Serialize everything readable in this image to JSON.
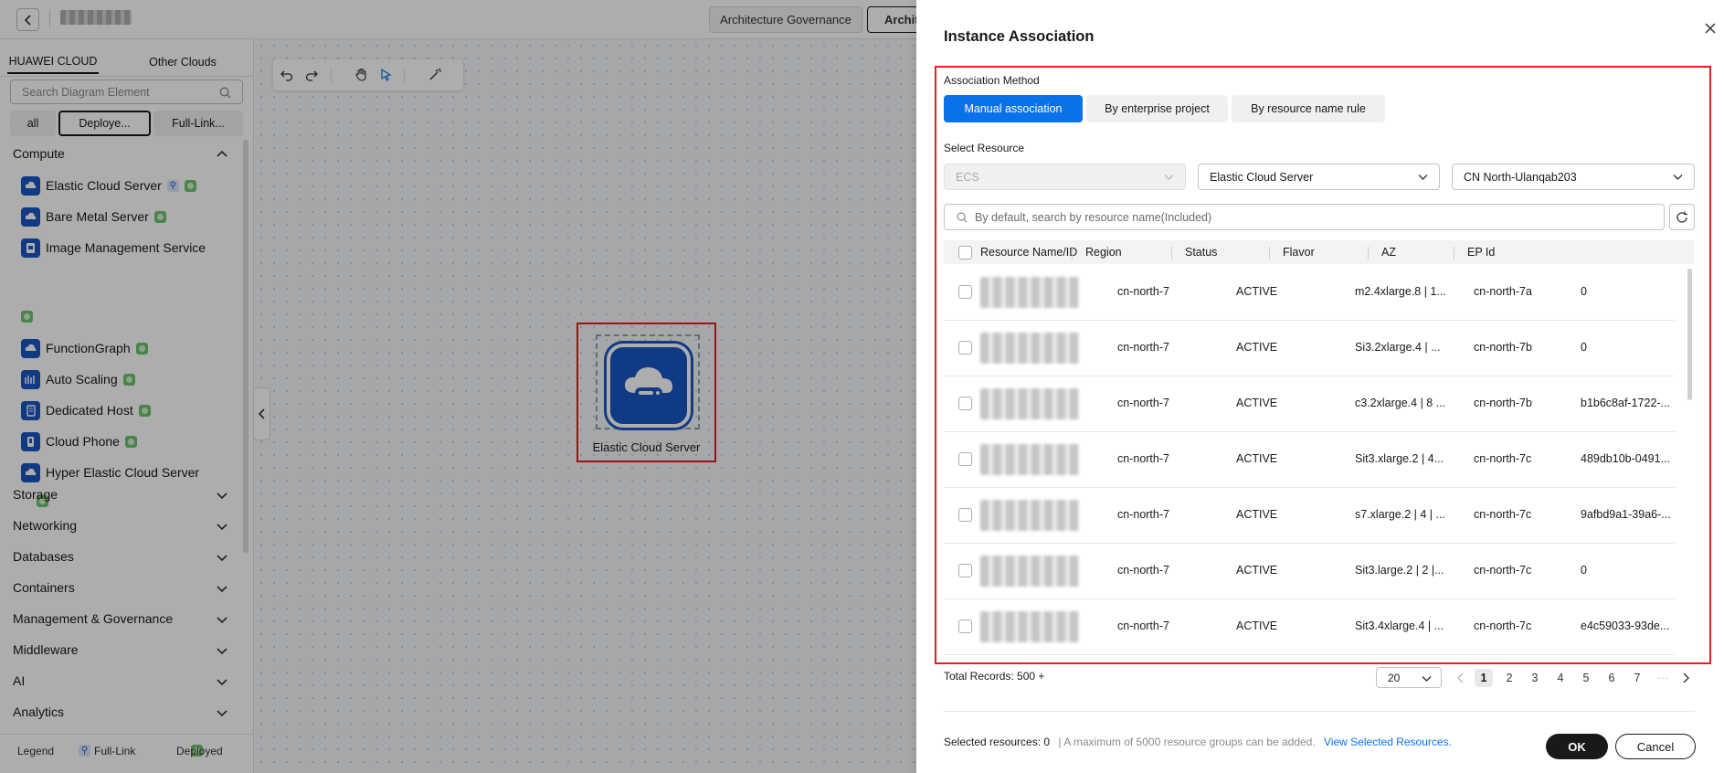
{
  "topbar": {
    "back_label": "Back",
    "tabs": [
      "Architecture Governance",
      "Archit"
    ]
  },
  "left": {
    "cloud_tabs": [
      "HUAWEI CLOUD",
      "Other Clouds"
    ],
    "search_placeholder": "Search Diagram Element",
    "filters": [
      "all",
      "Deploye...",
      "Full-Link..."
    ],
    "categories": {
      "compute": "Compute",
      "storage": "Storage",
      "networking": "Networking",
      "databases": "Databases",
      "containers": "Containers",
      "management": "Management & Governance",
      "middleware": "Middleware",
      "ai": "AI",
      "analytics": "Analytics"
    },
    "services": [
      "Elastic Cloud Server",
      "Bare Metal Server",
      "Image Management Service",
      "FunctionGraph",
      "Auto Scaling",
      "Dedicated Host",
      "Cloud Phone",
      "Hyper Elastic Cloud Server"
    ],
    "legend": {
      "title": "Legend",
      "full_link": "Full-Link",
      "deployed": "Deployed"
    }
  },
  "canvas": {
    "node_label": "Elastic Cloud Server"
  },
  "dialog": {
    "title": "Instance Association",
    "association_method_label": "Association Method",
    "methods": [
      "Manual association",
      "By enterprise project",
      "By resource name rule"
    ],
    "select_resource_label": "Select Resource",
    "select_type": "ECS",
    "select_service": "Elastic Cloud Server",
    "select_region": "CN North-Ulanqab203",
    "search_placeholder": "By default, search by resource name(Included)",
    "columns": [
      "Resource Name/ID",
      "Region",
      "Status",
      "Flavor",
      "AZ",
      "EP Id"
    ],
    "rows": [
      {
        "region": "cn-north-7",
        "status": "ACTIVE",
        "flavor": "m2.4xlarge.8 | 1...",
        "az": "cn-north-7a",
        "ep": "0"
      },
      {
        "region": "cn-north-7",
        "status": "ACTIVE",
        "flavor": "Si3.2xlarge.4 | ...",
        "az": "cn-north-7b",
        "ep": "0"
      },
      {
        "region": "cn-north-7",
        "status": "ACTIVE",
        "flavor": "c3.2xlarge.4 | 8 ...",
        "az": "cn-north-7b",
        "ep": "b1b6c8af-1722-..."
      },
      {
        "region": "cn-north-7",
        "status": "ACTIVE",
        "flavor": "Sit3.xlarge.2 | 4...",
        "az": "cn-north-7c",
        "ep": "489db10b-0491..."
      },
      {
        "region": "cn-north-7",
        "status": "ACTIVE",
        "flavor": "s7.xlarge.2 | 4 | ...",
        "az": "cn-north-7c",
        "ep": "9afbd9a1-39a6-..."
      },
      {
        "region": "cn-north-7",
        "status": "ACTIVE",
        "flavor": "Sit3.large.2 | 2 |...",
        "az": "cn-north-7c",
        "ep": "0"
      },
      {
        "region": "cn-north-7",
        "status": "ACTIVE",
        "flavor": "Sit3.4xlarge.4 | ...",
        "az": "cn-north-7c",
        "ep": "e4c59033-93de..."
      }
    ],
    "total_records": "Total Records: 500 +",
    "page_size": "20",
    "pages": [
      "1",
      "2",
      "3",
      "4",
      "5",
      "6",
      "7",
      "···"
    ],
    "current_page": "1",
    "selected_text": "Selected resources: 0",
    "max_text": "| A maximum of 5000 resource groups can be added.",
    "view_selected": "View Selected Resources.",
    "ok": "OK",
    "cancel": "Cancel"
  },
  "colors": {
    "accent": "#0b71e9",
    "brand_icon": "#1a56c4",
    "highlight_frame": "#e02020",
    "deployed_badge": "#6cc46c"
  }
}
